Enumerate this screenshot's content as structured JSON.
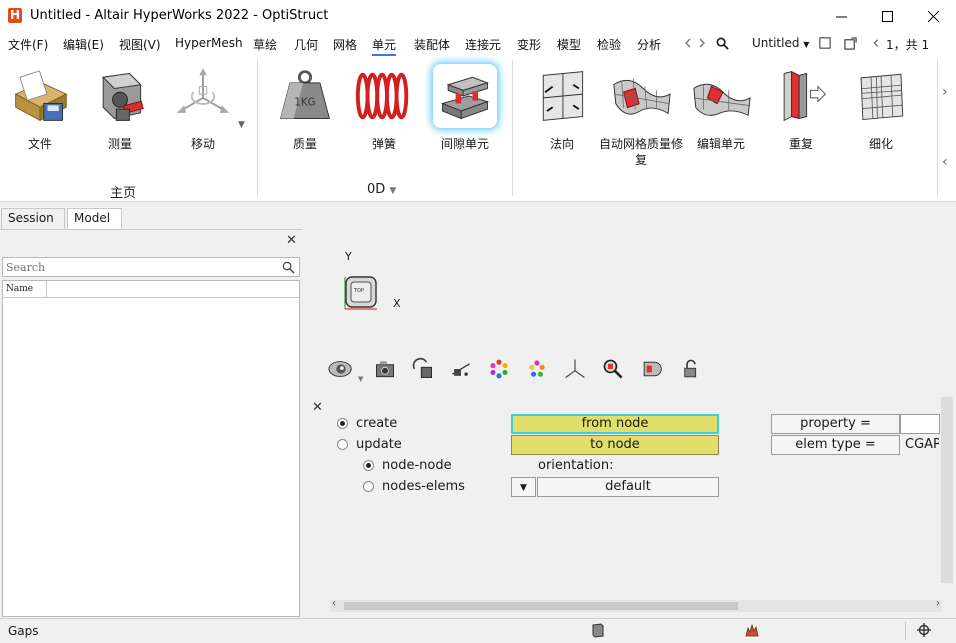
{
  "window": {
    "title": "Untitled - Altair HyperWorks 2022 - OptiStruct",
    "logo_letter": "H"
  },
  "menu": {
    "items": [
      {
        "label": "文件(F)"
      },
      {
        "label": "编辑(E)"
      },
      {
        "label": "视图(V)"
      },
      {
        "label": "HyperMesh"
      },
      {
        "label": "草绘"
      },
      {
        "label": "几何"
      },
      {
        "label": "网格"
      },
      {
        "label": "单元"
      },
      {
        "label": "装配体"
      },
      {
        "label": "连接元"
      },
      {
        "label": "变形"
      },
      {
        "label": "模型"
      },
      {
        "label": "检验"
      },
      {
        "label": "分析"
      }
    ],
    "active": "单元",
    "model_name": "Untitled",
    "page_indicator": "1，共 1"
  },
  "ribbon": {
    "tools": [
      {
        "label": "文件",
        "icon": "file-cabinet-icon"
      },
      {
        "label": "测量",
        "icon": "measure-icon"
      },
      {
        "label": "移动",
        "icon": "move-icon"
      },
      {
        "label": "质量",
        "icon": "mass-weight-icon"
      },
      {
        "label": "弹簧",
        "icon": "spring-icon"
      },
      {
        "label": "间隙单元",
        "icon": "gap-element-icon"
      },
      {
        "label": "法向",
        "icon": "normals-icon"
      },
      {
        "label": "自动网格质量修复",
        "icon": "auto-mesh-quality-icon"
      },
      {
        "label": "编辑单元",
        "icon": "edit-element-icon"
      },
      {
        "label": "重复",
        "icon": "duplicate-icon"
      },
      {
        "label": "细化",
        "icon": "refine-icon"
      }
    ],
    "groups": [
      {
        "label": "主页"
      },
      {
        "label": "0D"
      }
    ]
  },
  "left_panel": {
    "tabs": [
      {
        "label": "Session"
      },
      {
        "label": "Model"
      }
    ],
    "active_tab": "Model",
    "search_placeholder": "Search",
    "column_name": "Name"
  },
  "graphics": {
    "axis_y": "Y",
    "axis_x": "X",
    "cube_label": "TOP"
  },
  "form": {
    "modes": [
      {
        "label": "create",
        "selected": true
      },
      {
        "label": "update",
        "selected": false
      }
    ],
    "submodes": [
      {
        "label": "node-node",
        "selected": true
      },
      {
        "label": "nodes-elems",
        "selected": false
      }
    ],
    "from_node": "from node",
    "to_node": "to node",
    "orientation_label": "orientation:",
    "orientation_value": "default",
    "property_label": "property =",
    "property_value": "",
    "elem_type_label": "elem type =",
    "elem_type_value": "CGAP"
  },
  "status": {
    "text": "Gaps"
  },
  "colors": {
    "accent_underline": "#3a7bd5",
    "button_yellow": "#e1df6a",
    "focus_cyan": "#3ad0d8",
    "logo_orange": "#e8491d"
  }
}
